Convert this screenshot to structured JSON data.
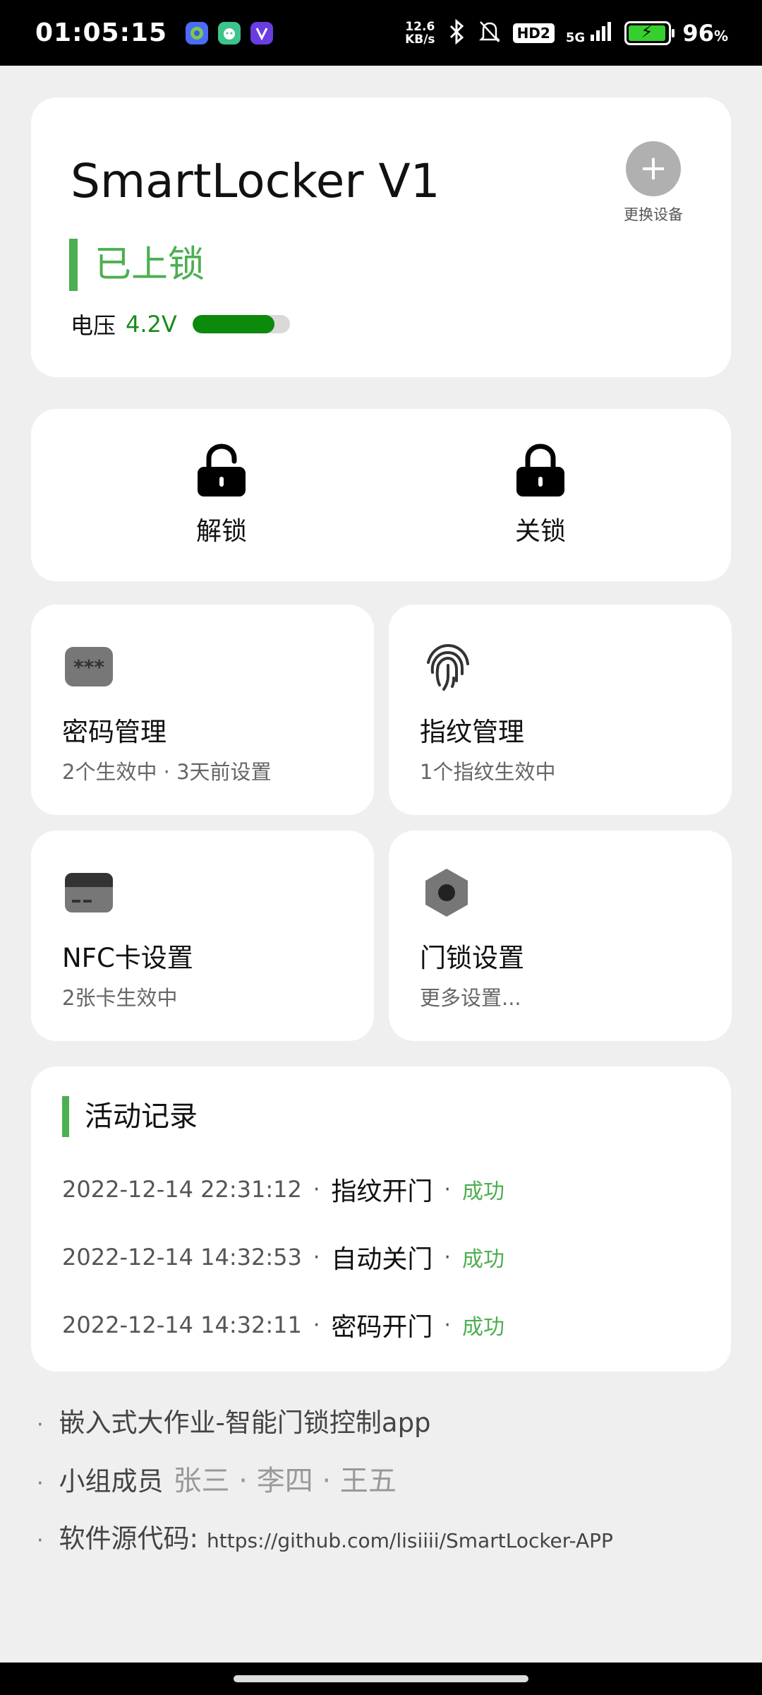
{
  "status_bar": {
    "time": "01:05:15",
    "net_speed_value": "12.6",
    "net_speed_unit": "KB/s",
    "hd_badge": "HD2",
    "network": "5G",
    "battery_percent": "96",
    "battery_unit": "%",
    "battery_level": 0.96
  },
  "device": {
    "name": "SmartLocker V1",
    "lock_status": "已上锁",
    "voltage_label": "电压",
    "voltage_value": "4.2V",
    "change_device_label": "更换设备"
  },
  "actions": {
    "unlock_label": "解锁",
    "lock_label": "关锁"
  },
  "tiles": {
    "password": {
      "title": "密码管理",
      "subtitle": "2个生效中 · 3天前设置"
    },
    "fingerprint": {
      "title": "指纹管理",
      "subtitle": "1个指纹生效中"
    },
    "nfc": {
      "title": "NFC卡设置",
      "subtitle": "2张卡生效中"
    },
    "settings": {
      "title": "门锁设置",
      "subtitle": "更多设置..."
    }
  },
  "activity": {
    "title": "活动记录",
    "separator": "·",
    "items": [
      {
        "time": "2022-12-14 22:31:12",
        "event": "指纹开门",
        "result": "成功"
      },
      {
        "time": "2022-12-14 14:32:53",
        "event": "自动关门",
        "result": "成功"
      },
      {
        "time": "2022-12-14 14:32:11",
        "event": "密码开门",
        "result": "成功"
      }
    ]
  },
  "footer": {
    "bullet": "·",
    "project": "嵌入式大作业-智能门锁控制app",
    "members_label": "小组成员",
    "members": "张三 · 李四 · 王五",
    "source_label": "软件源代码:",
    "source_url": "https://github.com/lisiiii/SmartLocker-APP"
  },
  "colors": {
    "accent_green": "#4caf50",
    "voltage_green": "#0c8a0c",
    "background": "#efefef"
  },
  "icons": [
    "silent-icon",
    "bluetooth-icon",
    "lock-open-icon",
    "lock-closed-icon",
    "password-icon",
    "fingerprint-icon",
    "card-icon",
    "settings-hex-icon",
    "plus-icon"
  ]
}
